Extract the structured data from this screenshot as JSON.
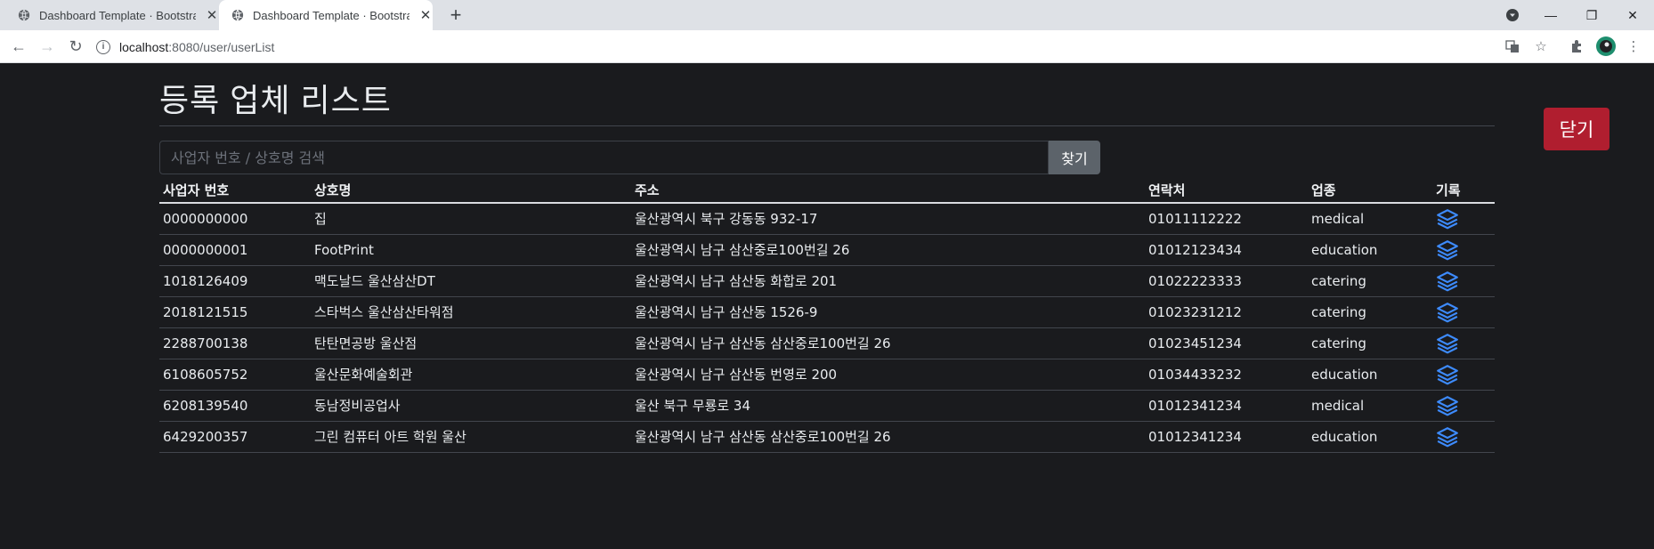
{
  "browser": {
    "tabs": [
      {
        "title": "Dashboard Template · Bootstrap"
      },
      {
        "title": "Dashboard Template · Bootstrap"
      }
    ],
    "url_host": "localhost",
    "url_rest": ":8080/user/userList"
  },
  "page": {
    "title": "등록 업체 리스트",
    "close_label": "닫기",
    "search_placeholder": "사업자 번호 / 상호명 검색",
    "search_button": "찾기",
    "columns": [
      "사업자 번호",
      "상호명",
      "주소",
      "연락처",
      "업종",
      "기록"
    ],
    "rows": [
      {
        "bizno": "0000000000",
        "name": "집",
        "address": "울산광역시 북구 강동동 932-17",
        "phone": "01011112222",
        "category": "medical"
      },
      {
        "bizno": "0000000001",
        "name": "FootPrint",
        "address": "울산광역시 남구 삼산중로100번길 26",
        "phone": "01012123434",
        "category": "education"
      },
      {
        "bizno": "1018126409",
        "name": "맥도날드 울산삼산DT",
        "address": "울산광역시 남구 삼산동 화합로 201",
        "phone": "01022223333",
        "category": "catering"
      },
      {
        "bizno": "2018121515",
        "name": "스타벅스 울산삼산타워점",
        "address": "울산광역시 남구 삼산동 1526-9",
        "phone": "01023231212",
        "category": "catering"
      },
      {
        "bizno": "2288700138",
        "name": "탄탄면공방 울산점",
        "address": "울산광역시 남구 삼산동 삼산중로100번길 26",
        "phone": "01023451234",
        "category": "catering"
      },
      {
        "bizno": "6108605752",
        "name": "울산문화예술회관",
        "address": "울산광역시 남구 삼산동 번영로 200",
        "phone": "01034433232",
        "category": "education"
      },
      {
        "bizno": "6208139540",
        "name": "동남정비공업사",
        "address": "울산 북구 무룡로 34",
        "phone": "01012341234",
        "category": "medical"
      },
      {
        "bizno": "6429200357",
        "name": "그린 컴퓨터 아트 학원 울산",
        "address": "울산광역시 남구 삼산동 삼산중로100번길 26",
        "phone": "01012341234",
        "category": "education"
      }
    ],
    "record_icon": "layers-icon",
    "colors": {
      "close": "#b01e2f",
      "icon": "#3d8bfd",
      "bg": "#1a1b1e"
    }
  }
}
